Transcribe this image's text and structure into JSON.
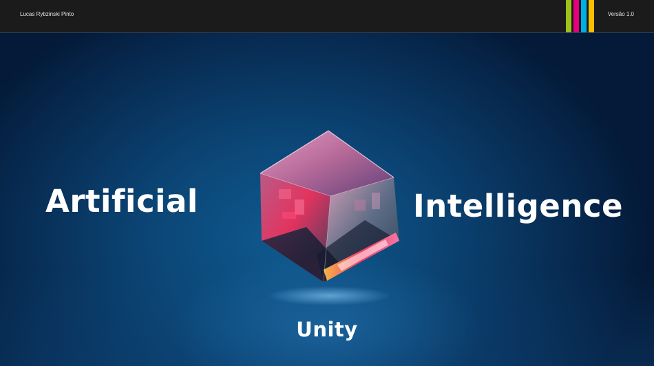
{
  "header": {
    "author": "Lucas Rybzinski Pinto",
    "version": "Versão 1.0",
    "stripe_colors": [
      "#9bc31b",
      "#e6007e",
      "#00aee8",
      "#f6bf00"
    ]
  },
  "hero": {
    "left_word": "Artificial",
    "right_word": "Intelligence",
    "bottom_word": "Unity",
    "image": "glass-cube"
  }
}
